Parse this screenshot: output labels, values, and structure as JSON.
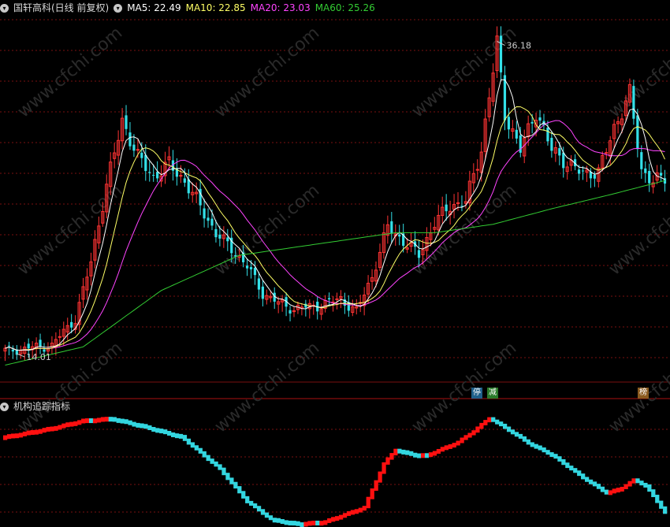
{
  "header": {
    "title": "国轩高科(日线 前复权)",
    "ma5": "MA5: 22.49",
    "ma10": "MA10: 22.85",
    "ma20": "MA20: 23.03",
    "ma60": "MA60: 25.26"
  },
  "indicator_panel": {
    "title": "机构追踪指标"
  },
  "badges": {
    "b1": "停",
    "b2": "减",
    "b3": "榜"
  },
  "watermark": "www.cfchi.com",
  "chart_data": [
    {
      "type": "candlestick",
      "title": "国轩高科(日线 前复权)",
      "ylim": [
        12,
        38
      ],
      "annotations": [
        {
          "label": "36.18",
          "kind": "high"
        },
        {
          "label": "14.01",
          "kind": "low"
        }
      ],
      "moving_averages": [
        {
          "name": "MA5",
          "value": 22.49,
          "color": "#ffffff"
        },
        {
          "name": "MA10",
          "value": 22.85,
          "color": "#ffff66"
        },
        {
          "name": "MA20",
          "value": 23.03,
          "color": "#ff44ff"
        },
        {
          "name": "MA60",
          "value": 25.26,
          "color": "#33cc33"
        }
      ],
      "colors": {
        "up": "#ff3333",
        "down": "#33e0e8",
        "grid": "#7a1010",
        "border": "#aa1111"
      },
      "anchors": [
        [
          0,
          14.2
        ],
        [
          12,
          14.6
        ],
        [
          18,
          16.5
        ],
        [
          22,
          20.5
        ],
        [
          26,
          26.0
        ],
        [
          30,
          30.5
        ],
        [
          34,
          28.0
        ],
        [
          38,
          26.5
        ],
        [
          42,
          27.5
        ],
        [
          46,
          26.2
        ],
        [
          50,
          24.5
        ],
        [
          54,
          22.5
        ],
        [
          58,
          21.5
        ],
        [
          62,
          20.2
        ],
        [
          66,
          18.3
        ],
        [
          70,
          17.6
        ],
        [
          74,
          17.2
        ],
        [
          80,
          17.4
        ],
        [
          86,
          17.9
        ],
        [
          90,
          17.0
        ],
        [
          94,
          19.5
        ],
        [
          98,
          23.0
        ],
        [
          102,
          22.0
        ],
        [
          106,
          21.0
        ],
        [
          110,
          23.3
        ],
        [
          114,
          24.5
        ],
        [
          118,
          24.8
        ],
        [
          122,
          28.5
        ],
        [
          126,
          36.1
        ],
        [
          128,
          31.0
        ],
        [
          132,
          28.5
        ],
        [
          136,
          31.2
        ],
        [
          140,
          28.5
        ],
        [
          144,
          27.5
        ],
        [
          148,
          26.8
        ],
        [
          152,
          26.9
        ],
        [
          156,
          30.0
        ],
        [
          160,
          32.5
        ],
        [
          163,
          27.0
        ],
        [
          166,
          26.3
        ],
        [
          169,
          26.4
        ]
      ],
      "n": 170,
      "ma60_curve": [
        [
          0,
          13.2
        ],
        [
          20,
          14.5
        ],
        [
          40,
          18.5
        ],
        [
          60,
          21.0
        ],
        [
          80,
          21.8
        ],
        [
          100,
          22.6
        ],
        [
          110,
          22.6
        ],
        [
          125,
          23.2
        ],
        [
          140,
          24.3
        ],
        [
          155,
          25.3
        ],
        [
          169,
          26.3
        ]
      ]
    },
    {
      "type": "bar",
      "title": "机构追踪指标",
      "colors": {
        "rising": "#ff1010",
        "falling": "#33d6e0"
      },
      "anchors": [
        [
          0,
          0.8
        ],
        [
          12,
          0.88
        ],
        [
          20,
          0.95
        ],
        [
          27,
          0.97
        ],
        [
          35,
          0.9
        ],
        [
          45,
          0.8
        ],
        [
          55,
          0.5
        ],
        [
          62,
          0.2
        ],
        [
          68,
          0.04
        ],
        [
          75,
          0.0
        ],
        [
          82,
          0.02
        ],
        [
          92,
          0.15
        ],
        [
          97,
          0.55
        ],
        [
          100,
          0.68
        ],
        [
          104,
          0.64
        ],
        [
          108,
          0.63
        ],
        [
          116,
          0.75
        ],
        [
          120,
          0.85
        ],
        [
          124,
          0.97
        ],
        [
          128,
          0.88
        ],
        [
          134,
          0.74
        ],
        [
          140,
          0.63
        ],
        [
          148,
          0.42
        ],
        [
          154,
          0.28
        ],
        [
          158,
          0.33
        ],
        [
          161,
          0.4
        ],
        [
          164,
          0.35
        ],
        [
          169,
          0.1
        ]
      ],
      "n": 170,
      "ylim": [
        0,
        1
      ]
    }
  ]
}
